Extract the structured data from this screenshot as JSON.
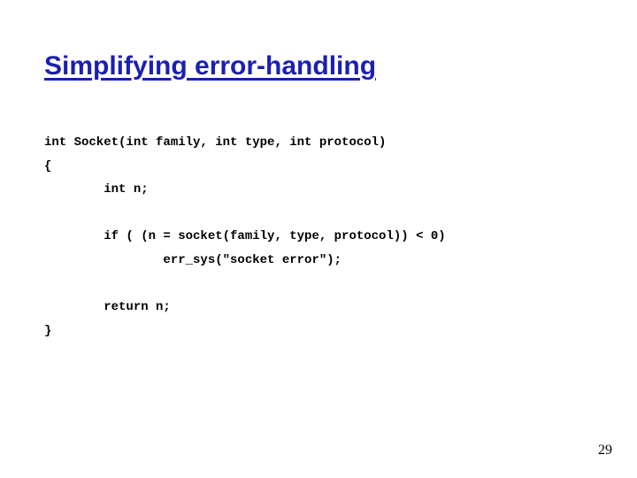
{
  "title": "Simplifying error-handling",
  "code": {
    "l1": "int Socket(int family, int type, int protocol)",
    "l2": "{",
    "l3": "        int n;",
    "l4": "",
    "l5": "        if ( (n = socket(family, type, protocol)) < 0)",
    "l6": "                err_sys(\"socket error\");",
    "l7": "",
    "l8": "        return n;",
    "l9": "}"
  },
  "page_number": "29"
}
